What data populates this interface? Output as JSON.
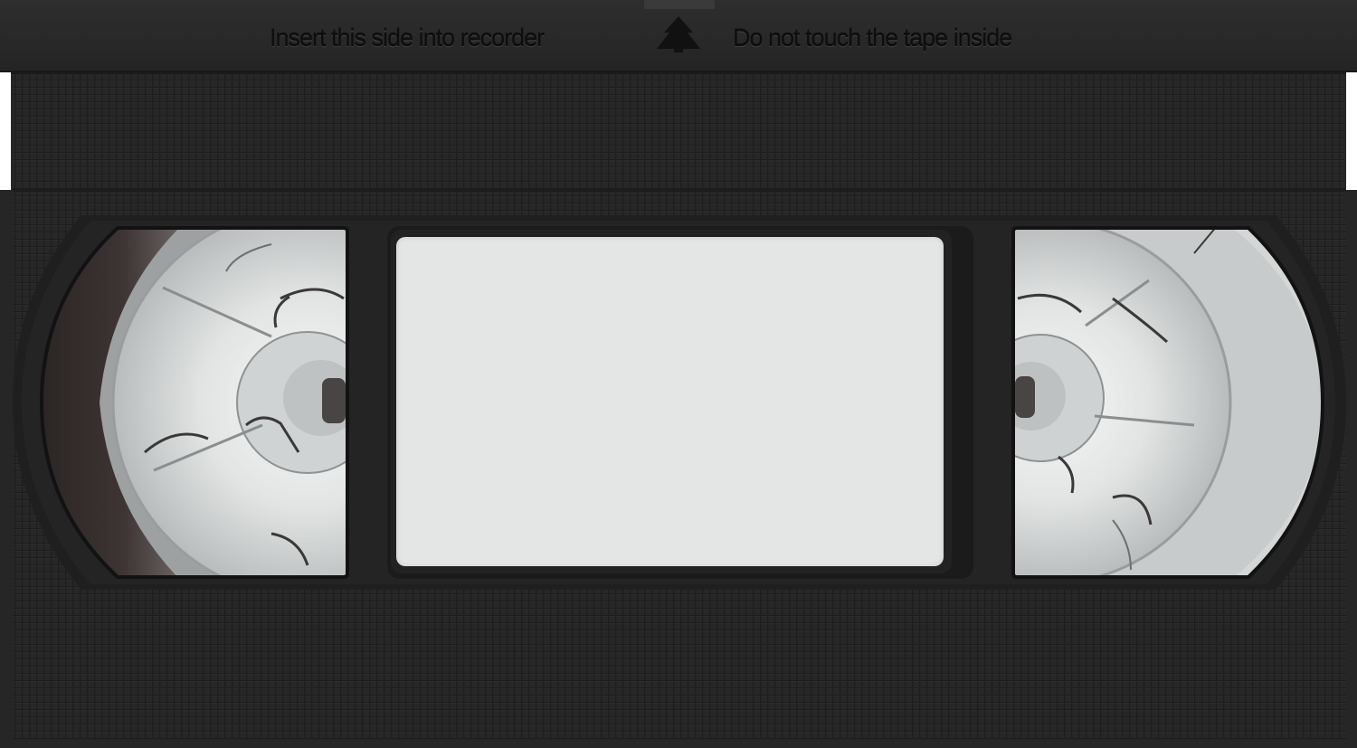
{
  "cassette": {
    "insert_text": "Insert this side into recorder",
    "warning_text": "Do not touch the tape inside",
    "colors": {
      "shell": "#262626",
      "label": "#e4e6e5",
      "reel": "#d9dcdb"
    },
    "icons": [
      "insert-arrow-icon"
    ]
  }
}
